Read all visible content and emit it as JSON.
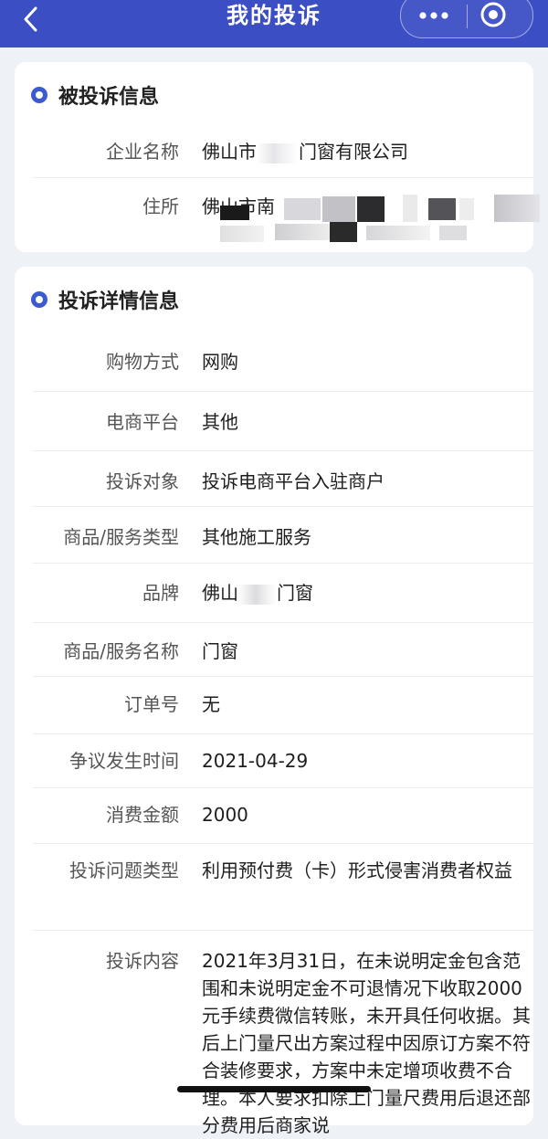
{
  "header": {
    "title": "我的投诉",
    "back_icon": "chevron-left-icon",
    "more_icon": "more-dots-icon",
    "close_icon": "target-icon"
  },
  "company_section": {
    "title": "被投诉信息",
    "rows": [
      {
        "label": "企业名称",
        "value_prefix": "佛山市",
        "value_suffix": "门窗有限公司"
      },
      {
        "label": "住所",
        "value_prefix": "佛山市南"
      }
    ]
  },
  "detail_section": {
    "title": "投诉详情信息",
    "rows": [
      {
        "label": "购物方式",
        "value": "网购"
      },
      {
        "label": "电商平台",
        "value": "其他"
      },
      {
        "label": "投诉对象",
        "value": "投诉电商平台入驻商户"
      },
      {
        "label": "商品/服务类型",
        "value": "其他施工服务"
      },
      {
        "label": "品牌",
        "value_prefix": "佛山",
        "value_suffix": "门窗"
      },
      {
        "label": "商品/服务名称",
        "value": "门窗"
      },
      {
        "label": "订单号",
        "value": "无"
      },
      {
        "label": "争议发生时间",
        "value": "2021-04-29"
      },
      {
        "label": "消费金额",
        "value": "2000"
      },
      {
        "label": "投诉问题类型",
        "value": "利用预付费（卡）形式侵害消费者权益"
      },
      {
        "label": "投诉内容",
        "value": "2021年3月31日，在未说明定金包含范围和未说明定金不可退情况下收取2000元手续费微信转账，未开具任何收据。其后上门量尺出方案过程中因原订方案不符合装修要求，方案中未定增项收费不合理。本人要求扣除上门量尺费用后退还部分费用后商家说"
      }
    ]
  }
}
